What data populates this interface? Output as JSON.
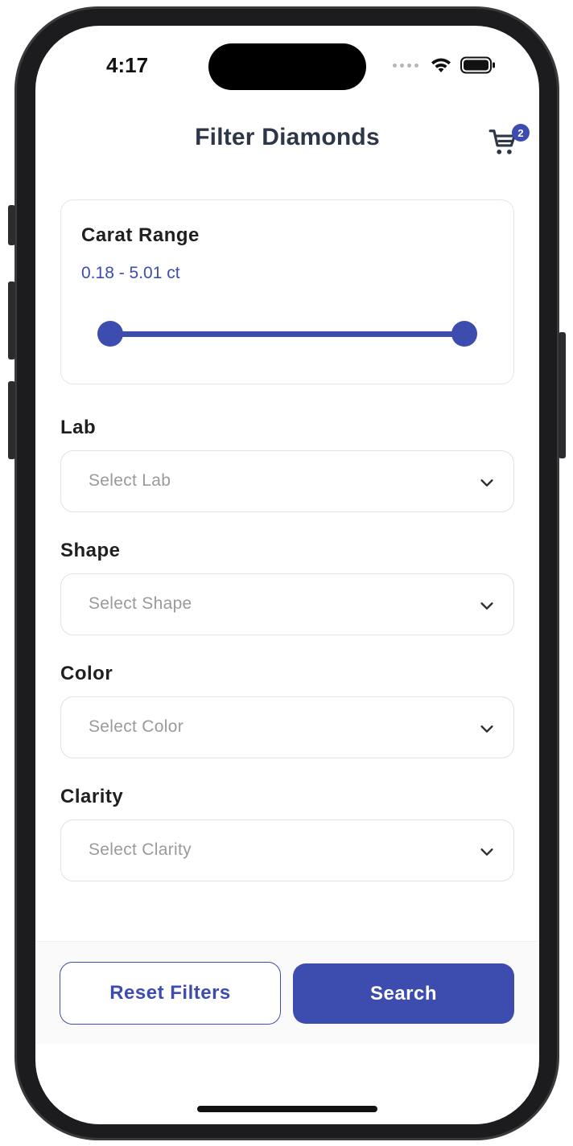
{
  "status_bar": {
    "time": "4:17",
    "icons": [
      "cellular-dots-icon",
      "wifi-icon",
      "battery-icon"
    ]
  },
  "header": {
    "title": "Filter Diamonds",
    "cart_icon": "cart-icon",
    "cart_count": "2"
  },
  "carat": {
    "title": "Carat Range",
    "range_text": "0.18 - 5.01 ct",
    "slider_min_position": 0,
    "slider_max_position": 1
  },
  "filters": [
    {
      "label": "Lab",
      "placeholder": "Select Lab"
    },
    {
      "label": "Shape",
      "placeholder": "Select Shape"
    },
    {
      "label": "Color",
      "placeholder": "Select Color"
    },
    {
      "label": "Clarity",
      "placeholder": "Select Clarity"
    }
  ],
  "actions": {
    "reset_label": "Reset Filters",
    "search_label": "Search"
  },
  "colors": {
    "accent": "#3d4caf",
    "title_text": "#2e3748",
    "placeholder_text": "#9a9a9a",
    "border": "#e0e2e6"
  }
}
